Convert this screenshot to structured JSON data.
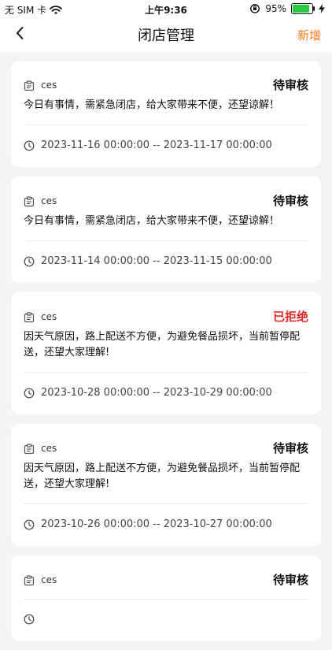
{
  "status_bar": {
    "carrier": "无 SIM 卡",
    "time": "上午9:36",
    "battery": "95%",
    "battery_level": 0.95
  },
  "nav": {
    "back_icon": "chevron-left-icon",
    "title": "闭店管理",
    "add_label": "新增"
  },
  "colors": {
    "accent": "#ff7a1a",
    "reject": "#e02828",
    "background": "#f4f4f6"
  },
  "records": [
    {
      "shop": "ces",
      "status": "待审核",
      "status_type": "pending",
      "reason": "今日有事情，需紧急闭店，给大家带来不便，还望谅解！",
      "start": "2023-11-16 00:00:00",
      "end": "2023-11-17 00:00:00"
    },
    {
      "shop": "ces",
      "status": "待审核",
      "status_type": "pending",
      "reason": "今日有事情，需紧急闭店，给大家带来不便，还望谅解！",
      "start": "2023-11-14 00:00:00",
      "end": "2023-11-15 00:00:00"
    },
    {
      "shop": "ces",
      "status": "已拒绝",
      "status_type": "reject",
      "reason": "因天气原因，路上配送不方便，为避免餐品损坏，当前暂停配送，还望大家理解!",
      "start": "2023-10-28 00:00:00",
      "end": "2023-10-29 00:00:00"
    },
    {
      "shop": "ces",
      "status": "待审核",
      "status_type": "pending",
      "reason": "因天气原因，路上配送不方便，为避免餐品损坏，当前暂停配送，还望大家理解!",
      "start": "2023-10-26 00:00:00",
      "end": "2023-10-27 00:00:00"
    },
    {
      "shop": "ces",
      "status": "待审核",
      "status_type": "pending",
      "reason": "",
      "start": "",
      "end": ""
    }
  ],
  "time_separator": "--"
}
